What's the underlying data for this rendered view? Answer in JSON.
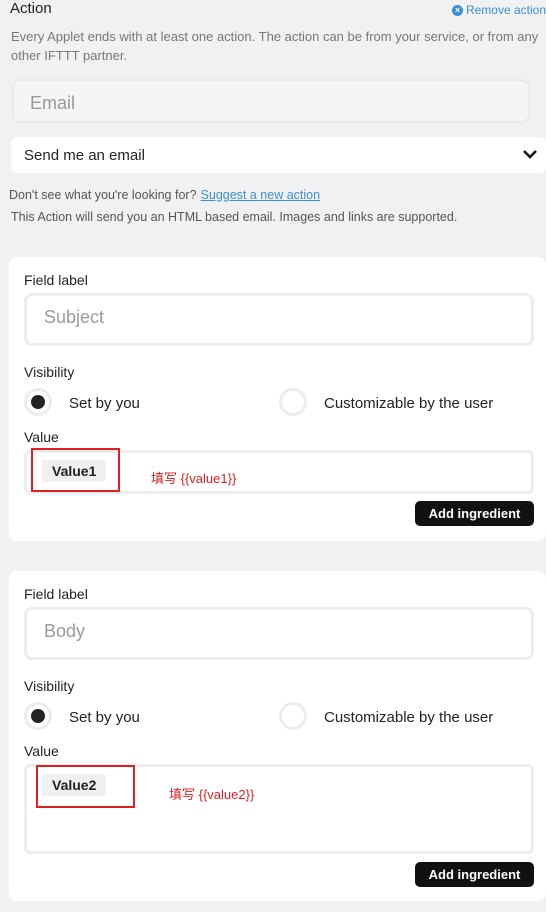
{
  "action": {
    "title": "Action",
    "remove_label": "Remove action",
    "description": "Every Applet ends with at least one action. The action can be from your service, or from any other IFTTT partner.",
    "service_placeholder": "Email",
    "selected_action": "Send me an email",
    "hint_prefix": "Don't see what you're looking for?",
    "hint_link": "Suggest a new action",
    "note": "This Action will send you an HTML based email. Images and links are supported."
  },
  "fields": [
    {
      "field_label_heading": "Field label",
      "field_label_placeholder": "Subject",
      "visibility_heading": "Visibility",
      "option_set_by_you": "Set by you",
      "option_customizable": "Customizable by the user",
      "value_heading": "Value",
      "value_chip": "Value1",
      "annotation": "填写 {{value1}}",
      "add_ingredient": "Add ingredient"
    },
    {
      "field_label_heading": "Field label",
      "field_label_placeholder": "Body",
      "visibility_heading": "Visibility",
      "option_set_by_you": "Set by you",
      "option_customizable": "Customizable by the user",
      "value_heading": "Value",
      "value_chip": "Value2",
      "annotation": "填写 {{value2}}",
      "add_ingredient": "Add ingredient"
    }
  ],
  "colors": {
    "link": "#3a8fd6",
    "annotation_red": "#e02020",
    "button_bg": "#111111"
  }
}
